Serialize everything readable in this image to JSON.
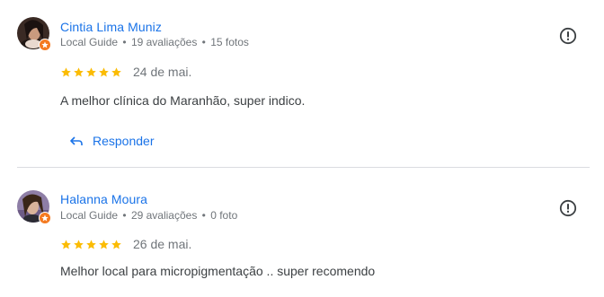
{
  "reviews": [
    {
      "author": "Cintia Lima Muniz",
      "guide_label": "Local Guide",
      "reviews_count": "19 avaliações",
      "photos_count": "15 fotos",
      "rating": 5,
      "date": "24 de mai.",
      "text": "A melhor clínica do Maranhão, super indico.",
      "reply_label": "Responder"
    },
    {
      "author": "Halanna Moura",
      "guide_label": "Local Guide",
      "reviews_count": "29 avaliações",
      "photos_count": "0 foto",
      "rating": 5,
      "date": "26 de mai.",
      "text": "Melhor local para micropigmentação .. super recomendo"
    }
  ],
  "separator": "•",
  "colors": {
    "author_link": "#1a73e8",
    "star": "#fbbc04",
    "meta_text": "#70757a",
    "local_guide_badge": "#f4791f",
    "divider": "#dadce0"
  },
  "icons": {
    "flag": "report-icon",
    "reply": "reply-arrow-icon",
    "badge": "local-guide-badge-icon",
    "star": "star-icon"
  }
}
